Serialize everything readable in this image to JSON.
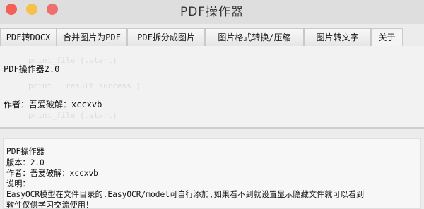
{
  "window": {
    "title": "PDF操作器"
  },
  "tabs": [
    {
      "label": "PDF转DOCX"
    },
    {
      "label": "合并图片为PDF"
    },
    {
      "label": "PDF拆分成图片"
    },
    {
      "label": "图片格式转换/压缩"
    },
    {
      "label": "图片转文字"
    },
    {
      "label": "关于"
    }
  ],
  "about": {
    "version_line": "PDF操作器2.0",
    "author_line": "作者：吾爱破解：xccxvb"
  },
  "output": {
    "lines": [
      "PDF操作器",
      "版本：2.0",
      "作者：吾爱破解：xccxvb",
      "说明：",
      "EasyOCR模型在文件目录的.EasyOCR/model可自行添加,如果看不到就设置显示隐藏文件就可以看到",
      "软件仅供学习交流使用！"
    ]
  }
}
